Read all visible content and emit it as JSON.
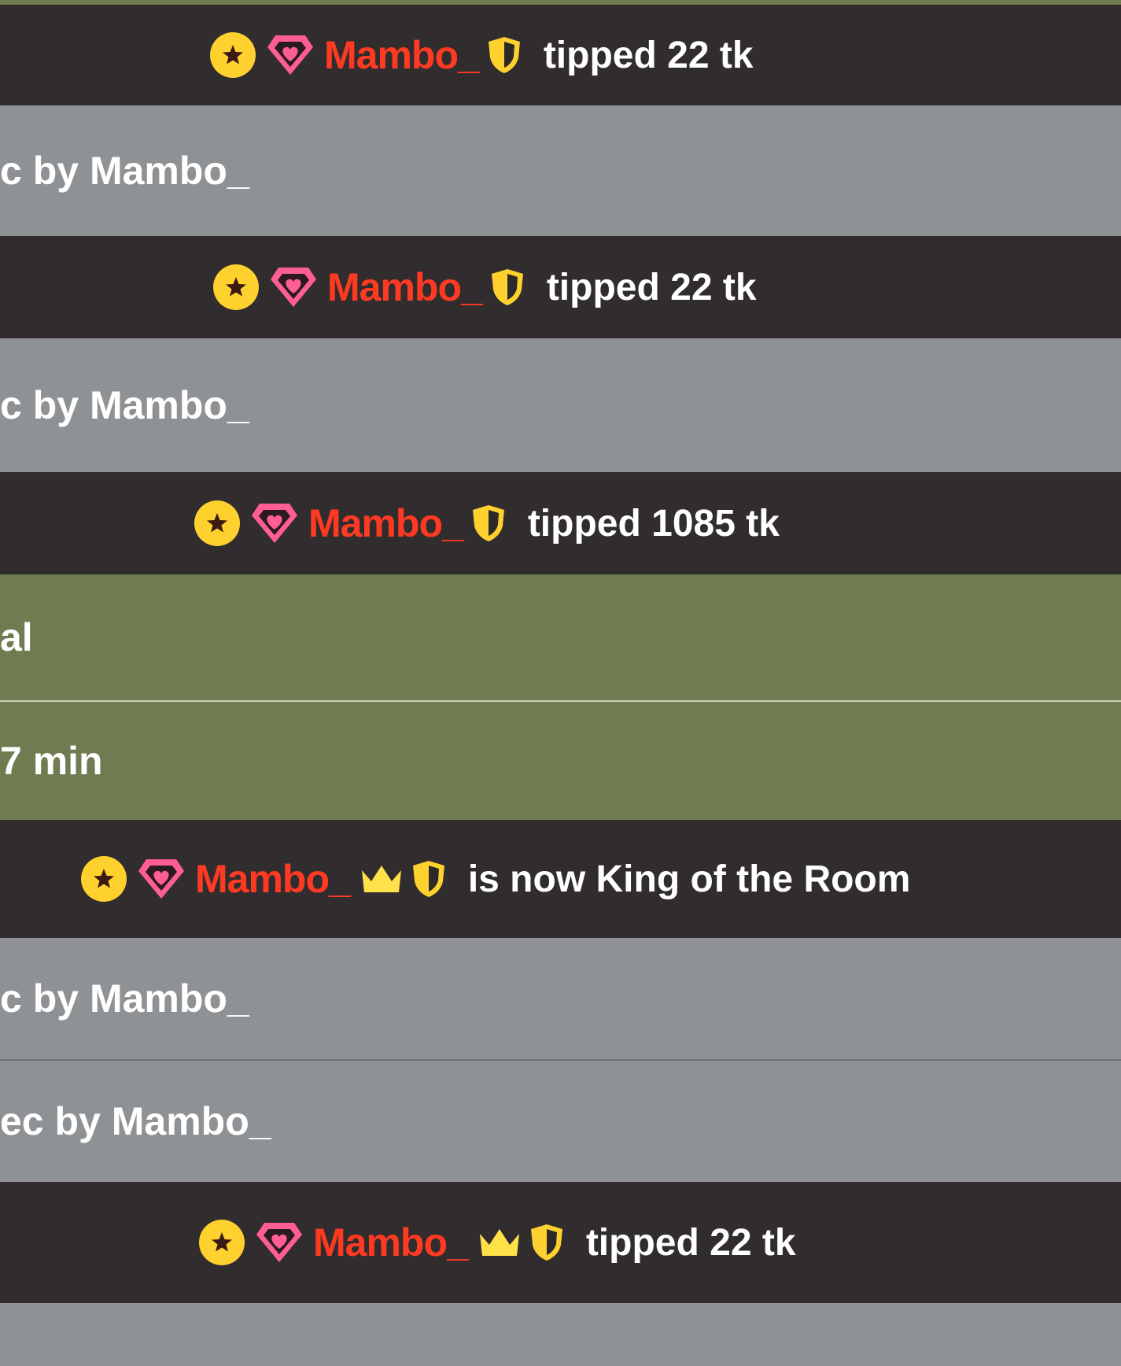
{
  "feed": {
    "tip1": {
      "username": "Mambo_",
      "message": "tipped 22 tk"
    },
    "gray1": {
      "text": "c by Mambo_"
    },
    "tip2": {
      "username": "Mambo_",
      "message": "tipped 22 tk"
    },
    "gray2": {
      "text": "c by Mambo_"
    },
    "tip3": {
      "username": "Mambo_",
      "message": "tipped 1085 tk"
    },
    "green1": {
      "text": "al"
    },
    "green2": {
      "text": "7 min"
    },
    "king": {
      "username": "Mambo_",
      "message": "is now King of the Room"
    },
    "gray3": {
      "text": "c by Mambo_"
    },
    "gray4": {
      "text": "ec by Mambo_"
    },
    "tip4": {
      "username": "Mambo_",
      "message": "tipped 22 tk"
    }
  },
  "colors": {
    "dark_row": "#312d2e",
    "gray_row": "#8f9295",
    "green_row": "#6f7b50",
    "username": "#ff3a22",
    "badge_yellow": "#ffd12e",
    "gem_pink": "#ff5d95"
  },
  "icons": [
    "star-badge-icon",
    "gem-icon",
    "shield-icon",
    "crown-icon"
  ]
}
